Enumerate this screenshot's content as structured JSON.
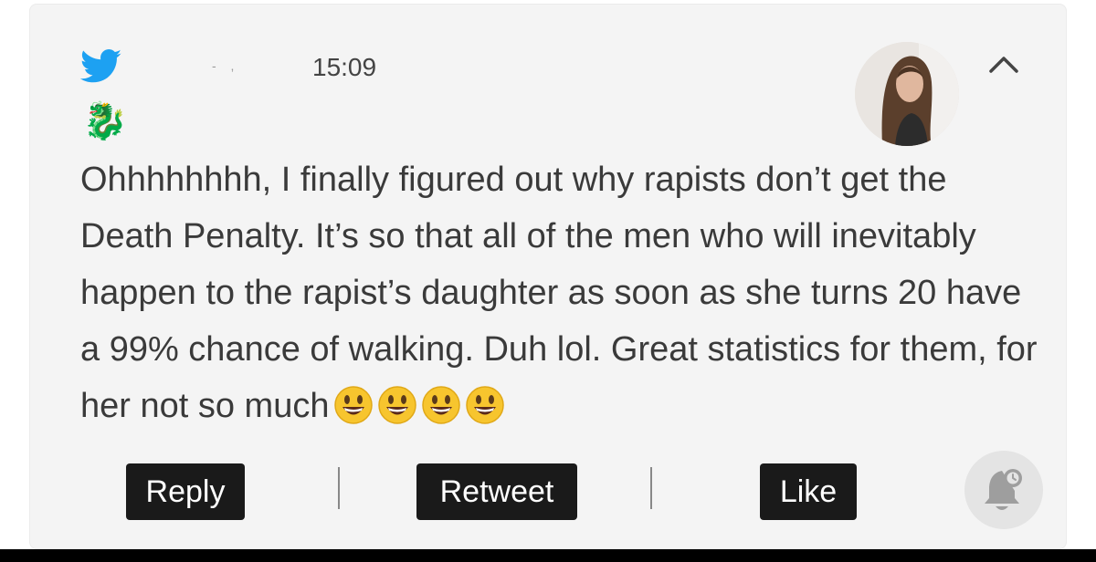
{
  "tweet": {
    "handle": "- ,",
    "time": "15:09",
    "text": "Ohhhhhhhh, I finally figured out why rapists don’t get the Death Penalty. It’s so that all of the men who will inevitably happen to the rapist’s daughter as soon as she turns 20 have a 99% chance of walking. Duh lol. Great statistics for them, for her not so much",
    "emoji_icons": [
      "grinning-face-icon",
      "grinning-face-icon",
      "grinning-face-icon",
      "grinning-face-icon"
    ],
    "badge_icon": "dragon-icon"
  },
  "actions": {
    "reply_label": "Reply",
    "retweet_label": "Retweet",
    "like_label": "Like"
  },
  "colors": {
    "twitter_blue": "#1da1f2",
    "button_bg": "#1a1a1a",
    "card_bg": "#f4f4f4",
    "text": "#3a3a3a"
  }
}
